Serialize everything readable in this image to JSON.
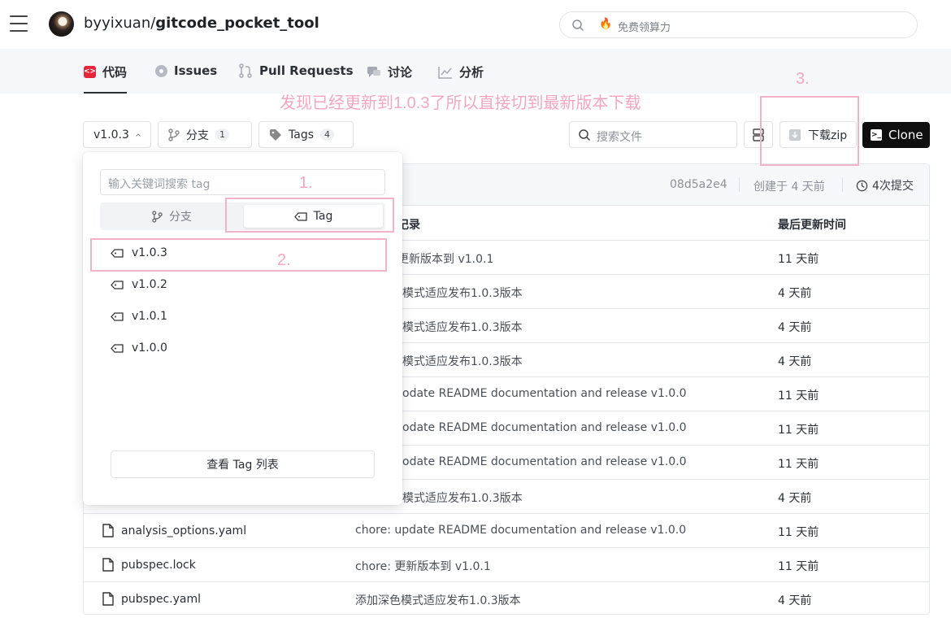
{
  "header": {
    "owner": "byyixuan/",
    "repo": "gitcode_pocket_tool",
    "search_placeholder": "免费领算力"
  },
  "tabs": [
    {
      "label": "代码",
      "active": true,
      "icon": "code-icon"
    },
    {
      "label": "Issues",
      "icon": "issue-icon"
    },
    {
      "label": "Pull Requests",
      "icon": "pull-request-icon"
    },
    {
      "label": "讨论",
      "icon": "discussion-icon"
    },
    {
      "label": "分析",
      "icon": "chart-icon"
    }
  ],
  "annotations": {
    "note": "发现已经更新到1.0.3了所以直接切到最新版本下载",
    "step1": "1.",
    "step2": "2.",
    "step3": "3.",
    "color": "#f4a6c0"
  },
  "toolbar": {
    "version_select": "v1.0.3",
    "branch_label": "分支",
    "branch_count": "1",
    "tags_label": "Tags",
    "tags_count": "4",
    "file_search_placeholder": "搜索文件",
    "download_label": "下载zip",
    "clone_label": "Clone"
  },
  "commit_bar": {
    "hash": "08d5a2e4",
    "created": "创建于 4 天前",
    "commits": "4次提交"
  },
  "table": {
    "col_message": "记录",
    "col_time": "最后更新时间",
    "rows": [
      {
        "name": "",
        "message": "更新版本到 v1.0.1",
        "time": "11 天前"
      },
      {
        "name": "",
        "message": "模式适应发布1.0.3版本",
        "time": "4 天前"
      },
      {
        "name": "",
        "message": "模式适应发布1.0.3版本",
        "time": "4 天前"
      },
      {
        "name": "",
        "message": "模式适应发布1.0.3版本",
        "time": "4 天前"
      },
      {
        "name": "",
        "message": "odate README documentation and release v1.0.0",
        "time": "11 天前"
      },
      {
        "name": "",
        "message": "odate README documentation and release v1.0.0",
        "time": "11 天前"
      },
      {
        "name": "",
        "message": "odate README documentation and release v1.0.0",
        "time": "11 天前"
      },
      {
        "name": "",
        "message": "模式适应发布1.0.3版本",
        "time": "4 天前"
      },
      {
        "name": "analysis_options.yaml",
        "message": "chore: update README documentation and release v1.0.0",
        "time": "11 天前"
      },
      {
        "name": "pubspec.lock",
        "message": "chore: 更新版本到 v1.0.1",
        "time": "11 天前"
      },
      {
        "name": "pubspec.yaml",
        "message": "添加深色模式适应发布1.0.3版本",
        "time": "4 天前"
      }
    ]
  },
  "dropdown": {
    "search_placeholder": "输入关键词搜索 tag",
    "seg_branch": "分支",
    "seg_tag": "Tag",
    "tags": [
      "v1.0.3",
      "v1.0.2",
      "v1.0.1",
      "v1.0.0"
    ],
    "view_all": "查看 Tag 列表"
  }
}
